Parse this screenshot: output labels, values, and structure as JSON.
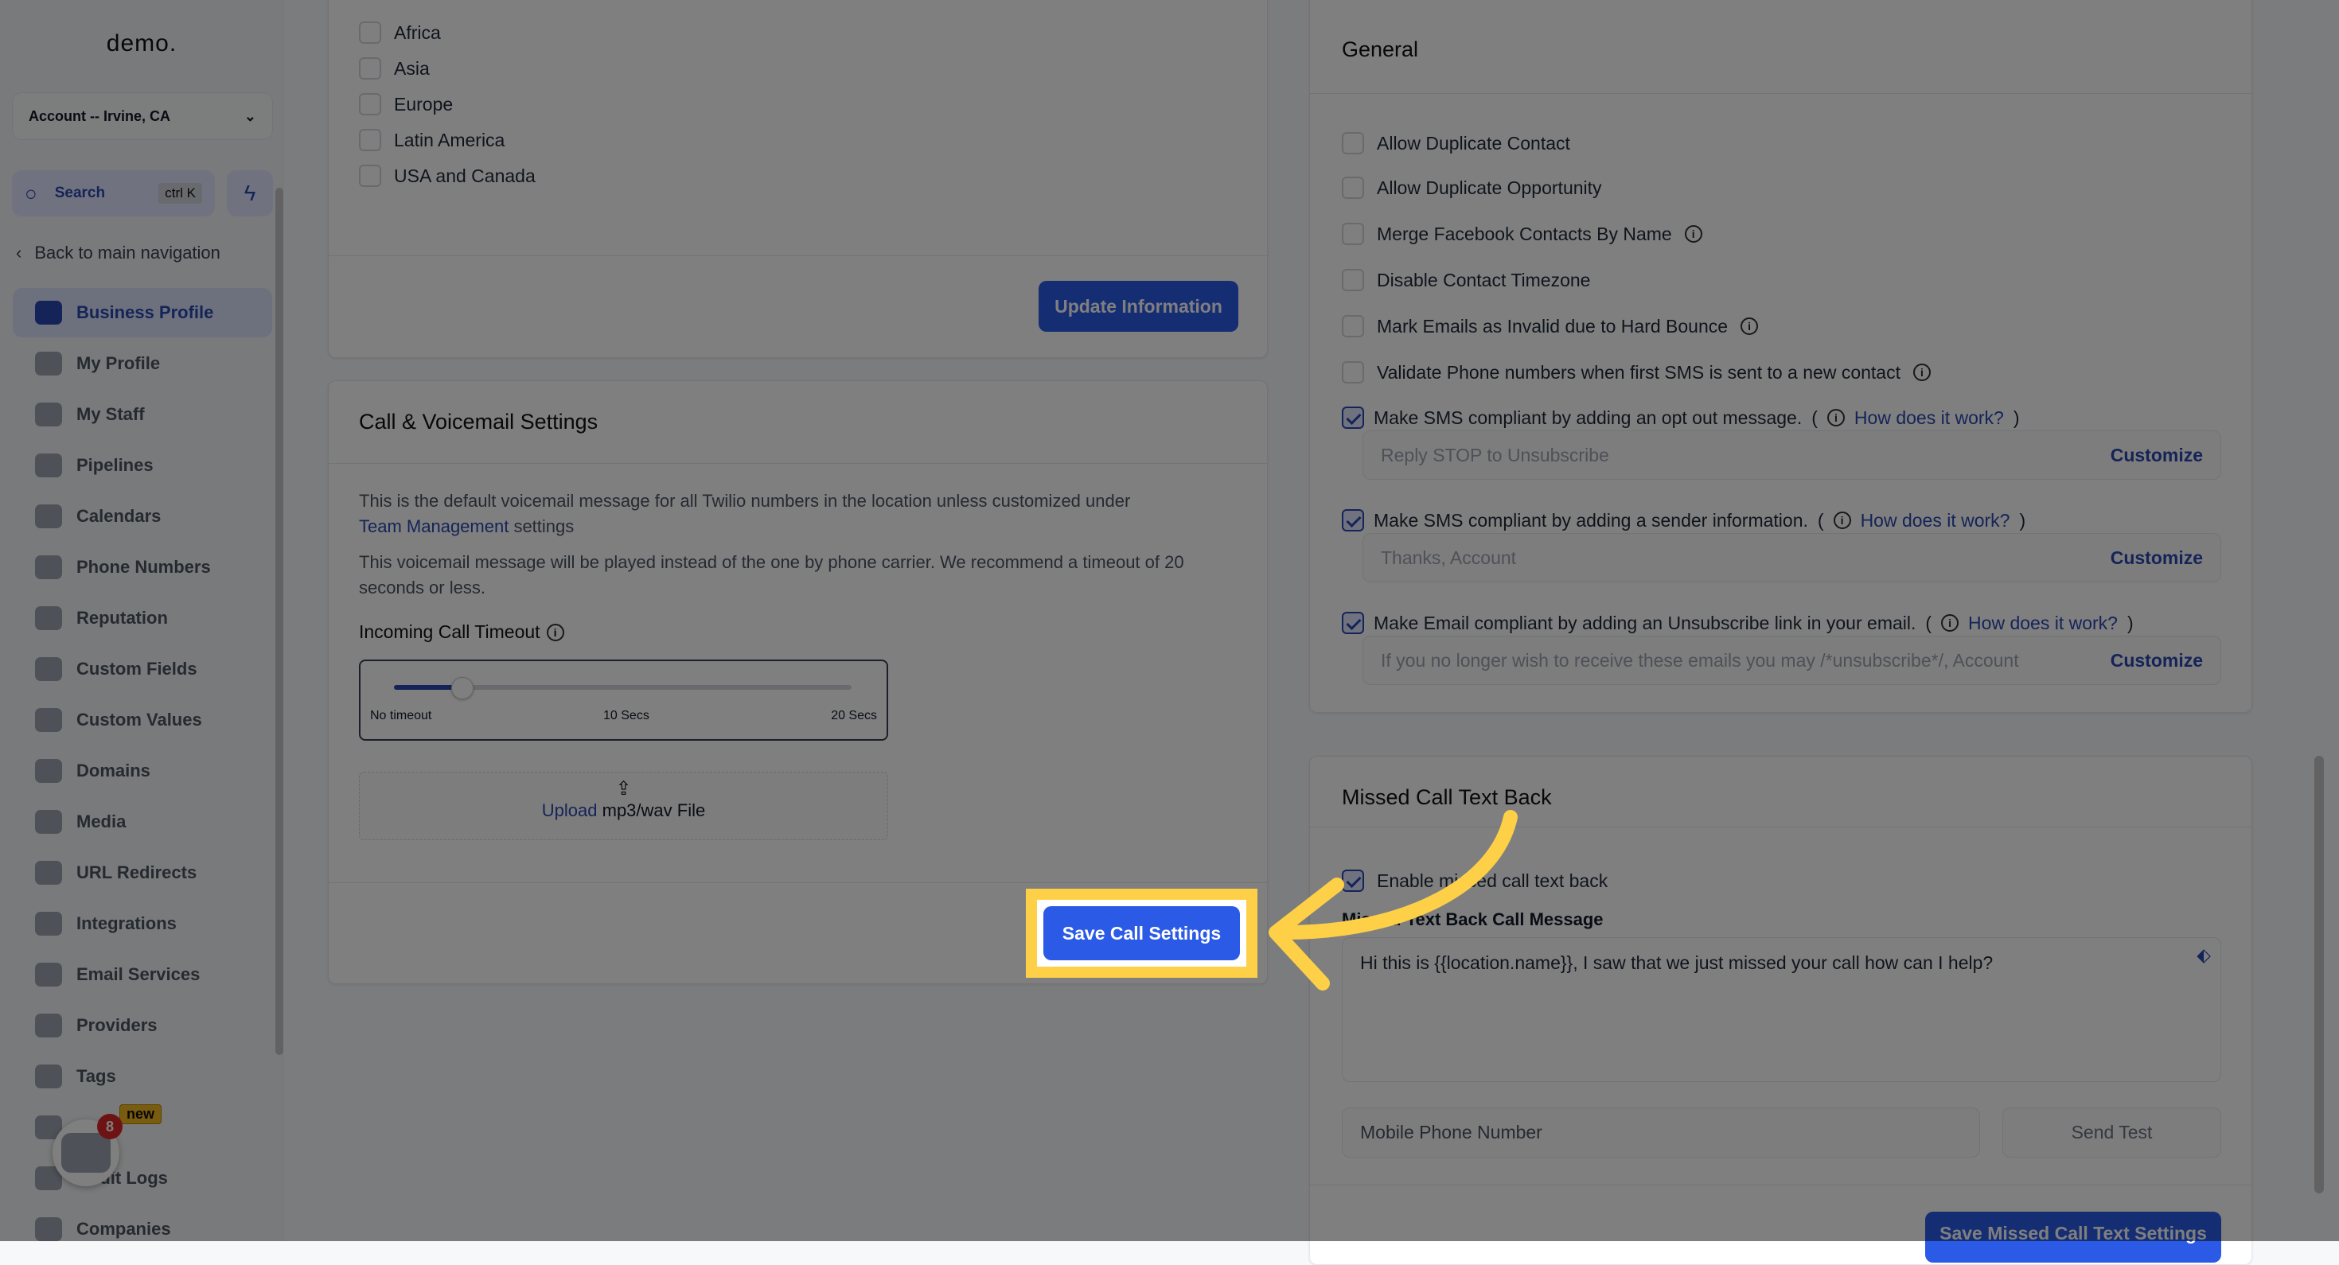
{
  "sidebar": {
    "logo": "demo.",
    "account": "Account -- Irvine, CA",
    "search_label": "Search",
    "search_shortcut": "ctrl K",
    "back": "Back to main navigation",
    "items": [
      {
        "label": "Business Profile",
        "active": true
      },
      {
        "label": "My Profile"
      },
      {
        "label": "My Staff"
      },
      {
        "label": "Pipelines"
      },
      {
        "label": "Calendars"
      },
      {
        "label": "Phone Numbers"
      },
      {
        "label": "Reputation"
      },
      {
        "label": "Custom Fields"
      },
      {
        "label": "Custom Values"
      },
      {
        "label": "Domains"
      },
      {
        "label": "Media"
      },
      {
        "label": "URL Redirects"
      },
      {
        "label": "Integrations"
      },
      {
        "label": "Email Services"
      },
      {
        "label": "Providers"
      },
      {
        "label": "Tags"
      },
      {
        "label": ""
      },
      {
        "label": "Audit Logs"
      },
      {
        "label": "Companies"
      }
    ],
    "new_badge": "new",
    "chat_count": "8"
  },
  "regions": {
    "items": [
      "Africa",
      "Asia",
      "Europe",
      "Latin America",
      "USA and Canada"
    ],
    "update_button": "Update Information"
  },
  "call": {
    "title": "Call & Voicemail Settings",
    "desc1": "This is the default voicemail message for all Twilio numbers in the location unless customized under",
    "desc1_link": "Team Management",
    "desc1_tail": " settings",
    "desc2": "This voicemail message will be played instead of the one by phone carrier. We recommend a timeout of 20 seconds or less.",
    "timeout_label": "Incoming Call Timeout",
    "slider": {
      "ticks": [
        "No timeout",
        "10 Secs",
        "20 Secs"
      ],
      "value_fraction": 0.15
    },
    "upload_link": "Upload",
    "upload_text": " mp3/wav File",
    "save_button": "Save Call Settings"
  },
  "general": {
    "title": "General",
    "options": [
      {
        "label": "Allow Duplicate Contact",
        "checked": false
      },
      {
        "label": "Allow Duplicate Opportunity",
        "checked": false
      },
      {
        "label": "Merge Facebook Contacts By Name",
        "checked": false,
        "info": true
      },
      {
        "label": "Disable Contact Timezone",
        "checked": false
      },
      {
        "label": "Mark Emails as Invalid due to Hard Bounce",
        "checked": false,
        "info": true
      },
      {
        "label": "Validate Phone numbers when first SMS is sent to a new contact",
        "checked": false,
        "info": true
      }
    ],
    "compliance": [
      {
        "label": "Make SMS compliant by adding an opt out message.",
        "link": "How does it work?",
        "placeholder": "Reply STOP to Unsubscribe",
        "customize": "Customize"
      },
      {
        "label": "Make SMS compliant by adding a sender information.",
        "link": "How does it work?",
        "placeholder": "Thanks, Account",
        "customize": "Customize"
      },
      {
        "label": "Make Email compliant by adding an Unsubscribe link in your email.",
        "link": "How does it work?",
        "placeholder": "If you no longer wish to receive these emails you may /*unsubscribe*/, Account",
        "customize": "Customize"
      }
    ]
  },
  "missed": {
    "title": "Missed Call Text Back",
    "enable_label": "Enable missed call text back",
    "message_label": "Missed Text Back Call Message",
    "message": "Hi this is {{location.name}}, I saw that we just missed your call how can I help?",
    "phone_placeholder": "Mobile Phone Number",
    "send_test": "Send Test",
    "save_button": "Save Missed Call Text Settings"
  },
  "colors": {
    "accent": "#2b5be6",
    "highlight": "#fdd047"
  }
}
